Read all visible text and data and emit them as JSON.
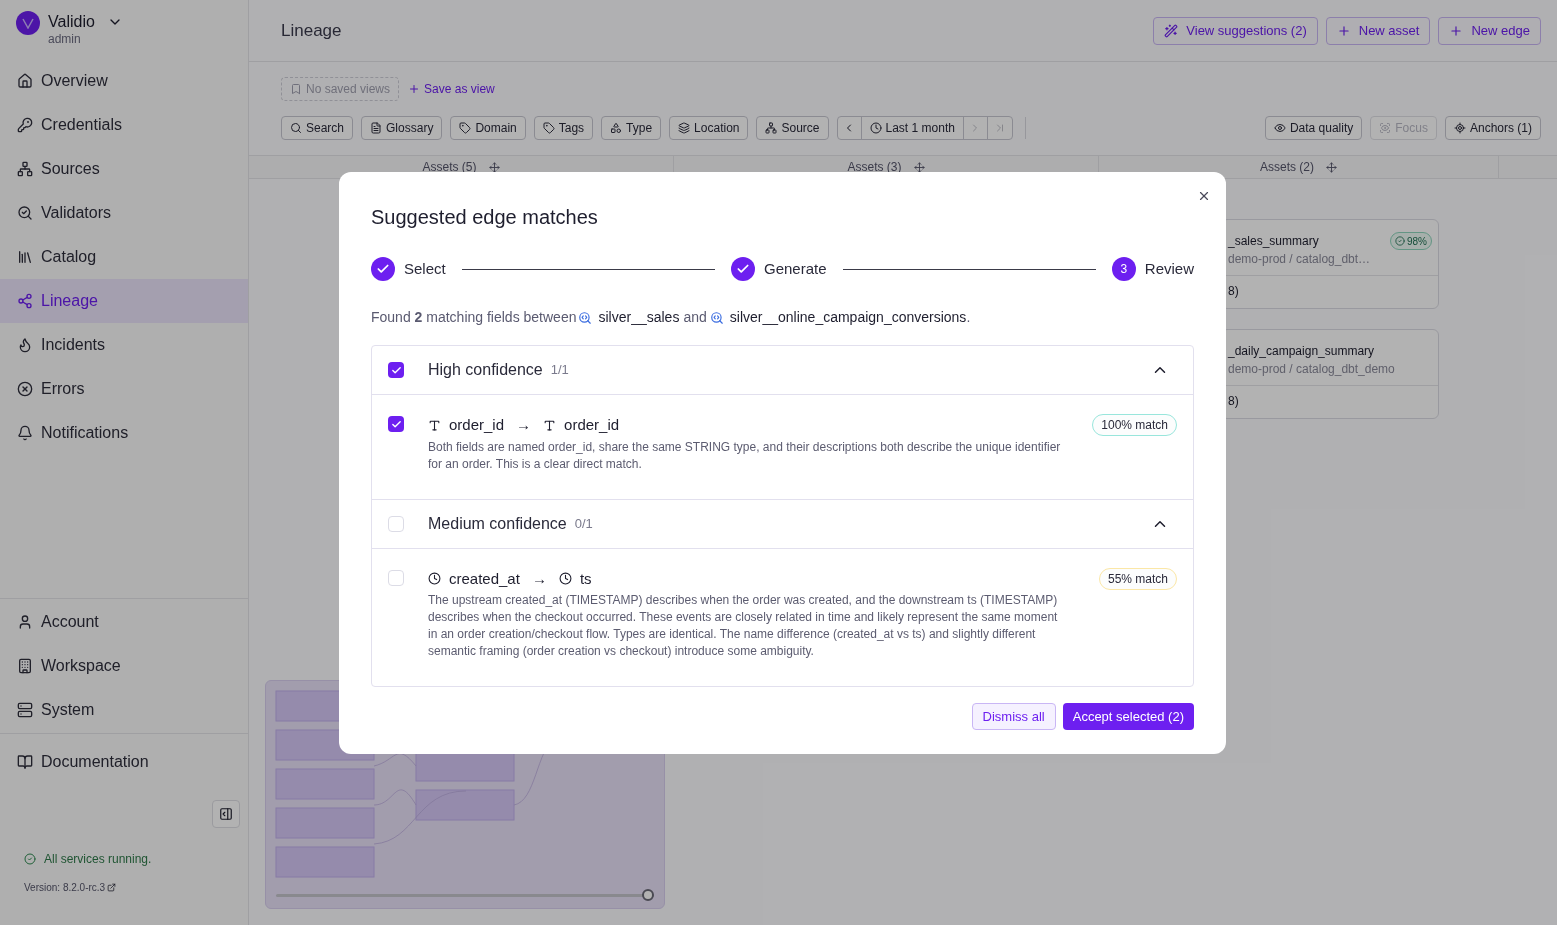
{
  "sidebar": {
    "org": "Validio",
    "role": "admin",
    "items": [
      {
        "label": "Overview",
        "selected": false
      },
      {
        "label": "Credentials",
        "selected": false
      },
      {
        "label": "Sources",
        "selected": false
      },
      {
        "label": "Validators",
        "selected": false
      },
      {
        "label": "Catalog",
        "selected": false
      },
      {
        "label": "Lineage",
        "selected": true
      },
      {
        "label": "Incidents",
        "selected": false
      },
      {
        "label": "Errors",
        "selected": false
      },
      {
        "label": "Notifications",
        "selected": false
      }
    ],
    "settings": [
      "Account",
      "Workspace",
      "System"
    ],
    "documentation": "Documentation",
    "status": "All services running.",
    "version": "Version: 8.2.0-rc.3"
  },
  "header": {
    "title": "Lineage",
    "actions": [
      "View suggestions (2)",
      "New asset",
      "New edge"
    ]
  },
  "views": {
    "placeholder": "No saved views",
    "save": "Save as view"
  },
  "filters": [
    "Search",
    "Glossary",
    "Domain",
    "Tags",
    "Type",
    "Location",
    "Source"
  ],
  "time_range": {
    "label": "Last 1 month",
    "next_disabled": true,
    "last_disabled": true
  },
  "view_options": [
    {
      "label": "Data quality",
      "disabled": false
    },
    {
      "label": "Focus",
      "disabled": true
    },
    {
      "label": "Anchors (1)",
      "disabled": false
    }
  ],
  "columns": [
    "Assets (5)",
    "Assets (3)",
    "Assets (2)"
  ],
  "assets": [
    {
      "name": "_sales_summary",
      "path": "demo-prod / catalog_dbt…",
      "score": "98%",
      "fields": "8)"
    },
    {
      "name": "_daily_campaign_summary",
      "path": "demo-prod / catalog_dbt_demo",
      "fields": "8)"
    }
  ],
  "minimap": {
    "zoom": {
      "level": 1
    }
  },
  "dialog": {
    "title": "Suggested edge matches",
    "steps": [
      {
        "label": "Select",
        "completed": true
      },
      {
        "label": "Generate",
        "completed": true
      },
      {
        "label": "Review",
        "completed": false,
        "number": "3"
      }
    ],
    "summary": {
      "prefix": "Found **2** matching fields between",
      "source": "silver__sales",
      "joiner": "and",
      "target": "silver__online_campaign_conversions",
      "suffix": "."
    },
    "groups": [
      {
        "title": "High confidence",
        "count": "1/1",
        "checked": true,
        "expanded": true,
        "matches": [
          {
            "kind": "string",
            "source": "order_id",
            "arrow": "→",
            "target": "order_id",
            "checked": true,
            "score": "100% match",
            "color": "#99e6dc",
            "description": "Both fields are named order_id, share the same STRING type, and their descriptions both describe the unique identifier for an order. This is a clear direct match."
          }
        ]
      },
      {
        "title": "Medium confidence",
        "count": "0/1",
        "checked": false,
        "expanded": true,
        "matches": [
          {
            "kind": "timestamp",
            "source": "created_at",
            "arrow": "→",
            "target": "ts",
            "checked": false,
            "score": "55% match",
            "color": "#fbe7a6",
            "description": "The upstream created_at (TIMESTAMP) describes when the order was created, and the downstream ts (TIMESTAMP) describes when the checkout occurred. These events are closely related in time and likely represent the same moment in an order creation/checkout flow. Types are identical. The name difference (created_at vs ts) and slightly different semantic framing (order creation vs checkout) introduce some ambiguity."
          }
        ]
      }
    ],
    "buttons": {
      "dismiss": "Dismiss all",
      "accept": "Accept selected (2)"
    }
  }
}
